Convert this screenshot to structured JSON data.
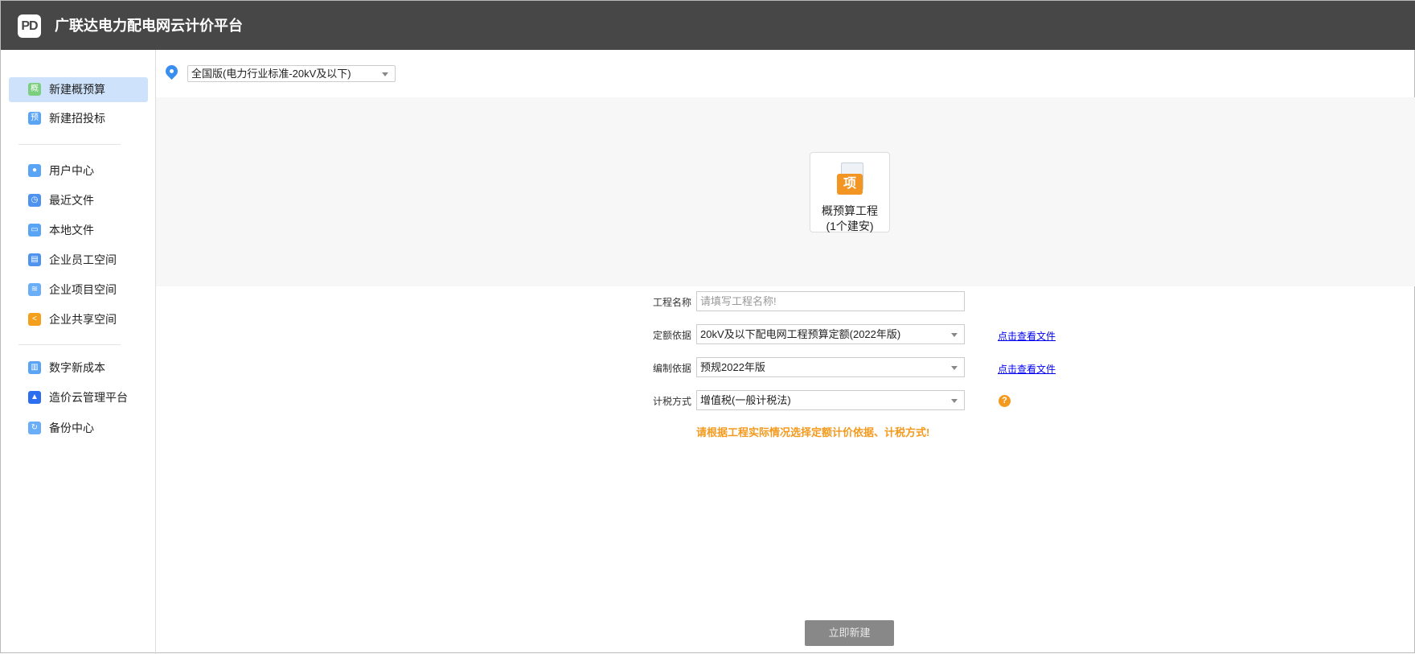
{
  "app": {
    "logo": "PD",
    "title": "广联达电力配电网云计价平台"
  },
  "sidebar": {
    "items": [
      {
        "label": "新建概预算",
        "icon": "gai-icon",
        "glyph": "概",
        "color": "#7ccf7e"
      },
      {
        "label": "新建招投标",
        "icon": "yu-icon",
        "glyph": "预",
        "color": "#5aa4f5"
      },
      {
        "label": "用户中心",
        "icon": "user-icon",
        "glyph": "●",
        "color": "#5aa4f5"
      },
      {
        "label": "最近文件",
        "icon": "recent-file-icon",
        "glyph": "◷",
        "color": "#4e93f0"
      },
      {
        "label": "本地文件",
        "icon": "local-file-icon",
        "glyph": "▭",
        "color": "#5aa4f5"
      },
      {
        "label": "企业员工空间",
        "icon": "building-icon",
        "glyph": "▤",
        "color": "#4e93f0"
      },
      {
        "label": "企业项目空间",
        "icon": "layers-icon",
        "glyph": "≋",
        "color": "#6aaef7"
      },
      {
        "label": "企业共享空间",
        "icon": "share-icon",
        "glyph": "<",
        "color": "#f5a01c"
      },
      {
        "label": "数字新成本",
        "icon": "digital-cost-icon",
        "glyph": "▥",
        "color": "#5aa4f5"
      },
      {
        "label": "造价云管理平台",
        "icon": "cloud-platform-icon",
        "glyph": "▲",
        "color": "#2d6ef0"
      },
      {
        "label": "备份中心",
        "icon": "backup-icon",
        "glyph": "↻",
        "color": "#6aaef7"
      }
    ]
  },
  "region": {
    "value": "全国版(电力行业标准-20kV及以下)"
  },
  "project_card": {
    "icon_glyph": "项",
    "line1": "概预算工程",
    "line2": "(1个建安)"
  },
  "form": {
    "name_label": "工程名称",
    "name_placeholder": "请填写工程名称!",
    "name_value": "",
    "quota_label": "定额依据",
    "quota_value": "20kV及以下配电网工程预算定额(2022年版)",
    "basis_label": "编制依据",
    "basis_value": "预规2022年版",
    "tax_label": "计税方式",
    "tax_value": "增值税(一般计税法)",
    "view_file_link": "点击查看文件",
    "help_glyph": "?",
    "warning": "请根据工程实际情况选择定额计价依据、计税方式!"
  },
  "create_button": "立即新建"
}
